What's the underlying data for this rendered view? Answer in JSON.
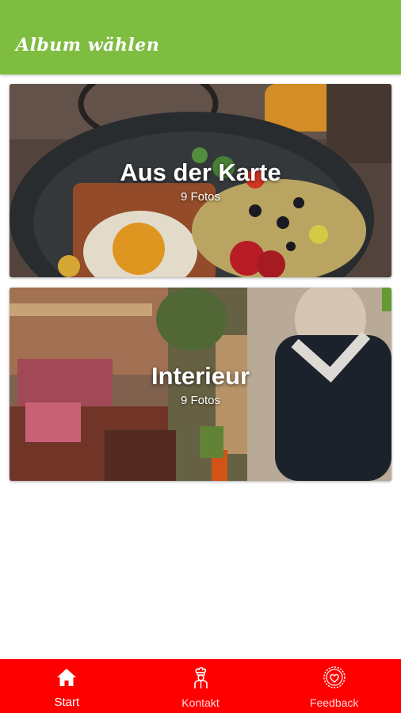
{
  "header": {
    "title": "Album wählen"
  },
  "albums": [
    {
      "title": "Aus der Karte",
      "count": "9 Fotos"
    },
    {
      "title": "Interieur",
      "count": "9 Fotos"
    }
  ],
  "tabbar": {
    "tabs": [
      {
        "label": "Start",
        "icon": "home-icon",
        "active": true
      },
      {
        "label": "Kontakt",
        "icon": "chef-icon",
        "active": false
      },
      {
        "label": "Feedback",
        "icon": "heart-badge-icon",
        "active": false
      }
    ]
  },
  "colors": {
    "header": "#7fbd41",
    "tabbar": "#ff0000"
  }
}
